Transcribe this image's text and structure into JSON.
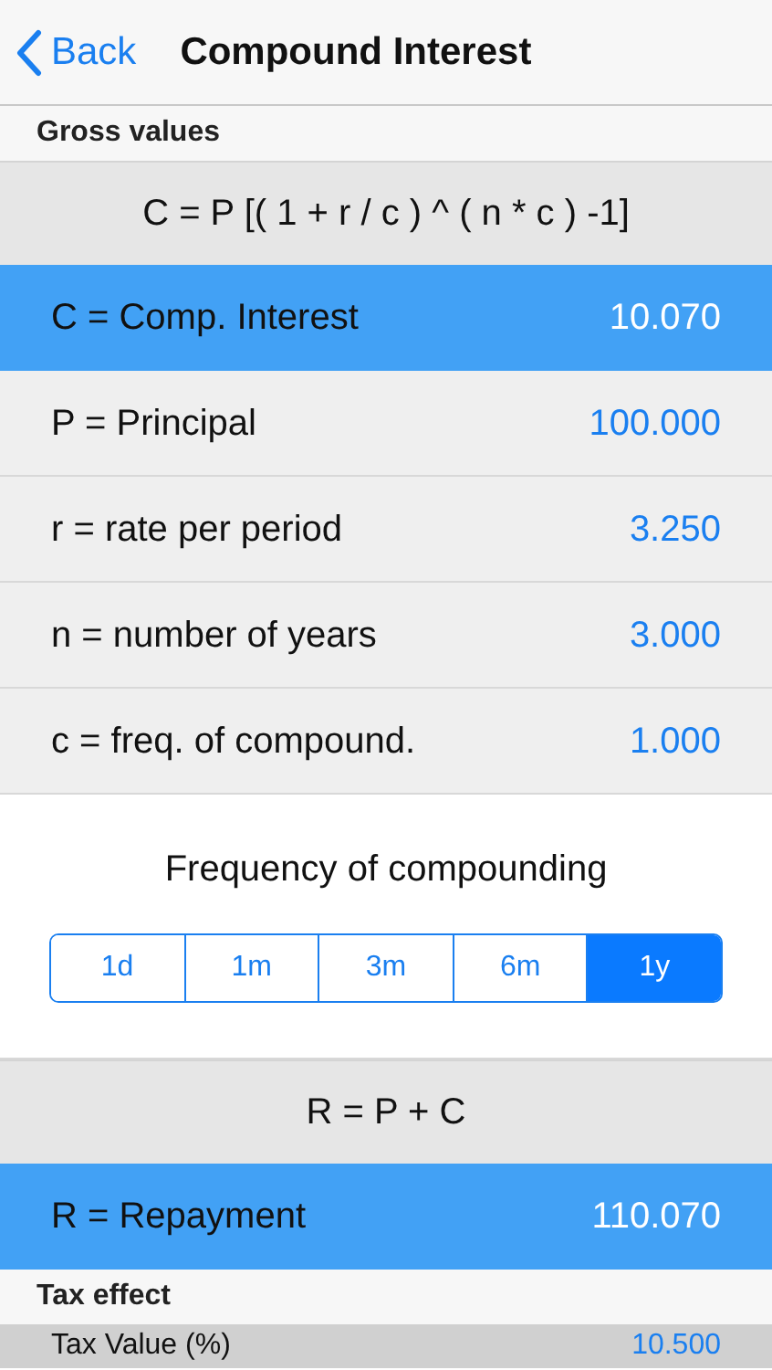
{
  "nav": {
    "back": "Back",
    "title": "Compound Interest"
  },
  "sections": [
    {
      "kind": "header",
      "text": "Gross values"
    },
    {
      "kind": "formula",
      "text": "C = P [( 1 + r / c ) ^ ( n * c ) -1]"
    },
    {
      "kind": "result",
      "label": "C = Comp. Interest",
      "value": "10.070"
    },
    {
      "kind": "input",
      "label": "P = Principal",
      "value": "100.000"
    },
    {
      "kind": "input",
      "label": "r =  rate per period",
      "value": "3.250"
    },
    {
      "kind": "input",
      "label": "n = number of years",
      "value": "3.000"
    },
    {
      "kind": "input",
      "label": "c = freq. of compound.",
      "value": "1.000"
    },
    {
      "kind": "segments",
      "title": "Frequency of compounding",
      "options": [
        {
          "label": "1d",
          "selected": false
        },
        {
          "label": "1m",
          "selected": false
        },
        {
          "label": "3m",
          "selected": false
        },
        {
          "label": "6m",
          "selected": false
        },
        {
          "label": "1y",
          "selected": true
        }
      ]
    },
    {
      "kind": "formula",
      "text": "R = P + C"
    },
    {
      "kind": "result",
      "label": "R = Repayment",
      "value": "110.070"
    },
    {
      "kind": "header",
      "text": "Tax effect"
    },
    {
      "kind": "partial",
      "label": "Tax Value (%)",
      "value": "10.500"
    }
  ]
}
